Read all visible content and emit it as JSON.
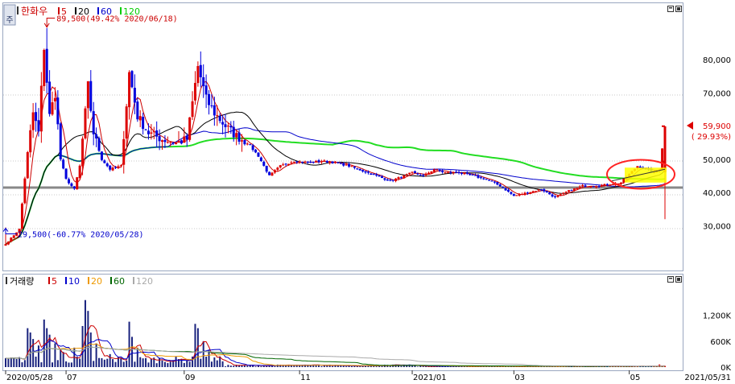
{
  "price_panel": {
    "symbol": "한화우",
    "ma_legend": [
      {
        "label": "5",
        "color": "#cc0000"
      },
      {
        "label": "20",
        "color": "#000000"
      },
      {
        "label": "60",
        "color": "#0000cc"
      },
      {
        "label": "120",
        "color": "#00cc00"
      }
    ],
    "high_annotation": "89,500(49.42% 2020/06/18)",
    "low_annotation": "29,500(-60.77% 2020/05/28)",
    "current_price": "59,900",
    "current_change": "( 29.93%)",
    "settings_icon_glyph": "주",
    "colors": {
      "up": "#dd0000",
      "down": "#0000dd",
      "ma5": "#cc0000",
      "ma20": "#000000",
      "ma60": "#0000cc",
      "ma120": "#22dd22",
      "support": "#888888",
      "circle": "#ff2222",
      "highlight": "#ffff00"
    }
  },
  "volume_panel": {
    "title": "거래량",
    "ma_legend": [
      {
        "label": "5",
        "color": "#cc0000"
      },
      {
        "label": "10",
        "color": "#0000cc"
      },
      {
        "label": "20",
        "color": "#ee9900"
      },
      {
        "label": "60",
        "color": "#006600"
      },
      {
        "label": "120",
        "color": "#aaaaaa"
      }
    ]
  },
  "x_axis": {
    "labels": [
      {
        "text": "2020/05/28",
        "idx": 0
      },
      {
        "text": "07",
        "idx": 22
      },
      {
        "text": "09",
        "idx": 65
      },
      {
        "text": "11",
        "idx": 107
      },
      {
        "text": "2021/01",
        "idx": 148
      },
      {
        "text": "03",
        "idx": 185
      },
      {
        "text": "05",
        "idx": 227
      }
    ],
    "end_label": "2021/05/31"
  },
  "chart_data": [
    {
      "type": "candlestick",
      "title": "한화우",
      "x_start": "2020/05/28",
      "x_end": "2021/05/31",
      "y_ticks": [
        30000,
        40000,
        50000,
        60000,
        70000,
        80000
      ],
      "ylim": [
        18000,
        96000
      ],
      "support_level": 41500,
      "anchors": [
        {
          "i": 0,
          "p": 24500
        },
        {
          "i": 5,
          "p": 29000
        },
        {
          "i": 8,
          "p": 52000
        },
        {
          "i": 10,
          "p": 64000
        },
        {
          "i": 12,
          "p": 58000
        },
        {
          "i": 14,
          "p": 84000
        },
        {
          "i": 16,
          "p": 63000
        },
        {
          "i": 18,
          "p": 70000
        },
        {
          "i": 20,
          "p": 50000
        },
        {
          "i": 22,
          "p": 44000
        },
        {
          "i": 25,
          "p": 41000
        },
        {
          "i": 27,
          "p": 48000
        },
        {
          "i": 30,
          "p": 72000
        },
        {
          "i": 32,
          "p": 58000
        },
        {
          "i": 35,
          "p": 50000
        },
        {
          "i": 38,
          "p": 47000
        },
        {
          "i": 42,
          "p": 48000
        },
        {
          "i": 45,
          "p": 76000
        },
        {
          "i": 48,
          "p": 63000
        },
        {
          "i": 52,
          "p": 58000
        },
        {
          "i": 57,
          "p": 56000
        },
        {
          "i": 62,
          "p": 55000
        },
        {
          "i": 66,
          "p": 56000
        },
        {
          "i": 70,
          "p": 78000
        },
        {
          "i": 73,
          "p": 68000
        },
        {
          "i": 76,
          "p": 64000
        },
        {
          "i": 80,
          "p": 60000
        },
        {
          "i": 84,
          "p": 57000
        },
        {
          "i": 88,
          "p": 55000
        },
        {
          "i": 92,
          "p": 51000
        },
        {
          "i": 96,
          "p": 45000
        },
        {
          "i": 100,
          "p": 48000
        },
        {
          "i": 105,
          "p": 49500
        },
        {
          "i": 110,
          "p": 49000
        },
        {
          "i": 115,
          "p": 49500
        },
        {
          "i": 120,
          "p": 49000
        },
        {
          "i": 125,
          "p": 48000
        },
        {
          "i": 130,
          "p": 46500
        },
        {
          "i": 135,
          "p": 45000
        },
        {
          "i": 140,
          "p": 43500
        },
        {
          "i": 145,
          "p": 45000
        },
        {
          "i": 148,
          "p": 46000
        },
        {
          "i": 152,
          "p": 45000
        },
        {
          "i": 156,
          "p": 47000
        },
        {
          "i": 160,
          "p": 46000
        },
        {
          "i": 165,
          "p": 46000
        },
        {
          "i": 170,
          "p": 45000
        },
        {
          "i": 175,
          "p": 44000
        },
        {
          "i": 180,
          "p": 42000
        },
        {
          "i": 185,
          "p": 39000
        },
        {
          "i": 190,
          "p": 40000
        },
        {
          "i": 195,
          "p": 41000
        },
        {
          "i": 200,
          "p": 38500
        },
        {
          "i": 205,
          "p": 40500
        },
        {
          "i": 210,
          "p": 42000
        },
        {
          "i": 215,
          "p": 42000
        },
        {
          "i": 220,
          "p": 42500
        },
        {
          "i": 224,
          "p": 43000
        },
        {
          "i": 227,
          "p": 45500
        },
        {
          "i": 230,
          "p": 48000
        },
        {
          "i": 233,
          "p": 47000
        },
        {
          "i": 236,
          "p": 46000
        },
        {
          "i": 238,
          "p": 47000
        },
        {
          "i": 240,
          "p": 59900
        }
      ],
      "current": {
        "value": 59900,
        "change_pct": 29.93
      },
      "high": {
        "value": 89500,
        "date": "2020/06/18",
        "pct": 49.42
      },
      "low": {
        "value": 29500,
        "date": "2020/05/28",
        "pct": -60.77
      }
    },
    {
      "type": "bar",
      "title": "거래량",
      "y_ticks": [
        {
          "value": 0,
          "label": "0K"
        },
        {
          "value": 600000,
          "label": "600K"
        },
        {
          "value": 1200000,
          "label": "1,200K"
        }
      ],
      "ylim": [
        0,
        1750000
      ],
      "spikes": [
        {
          "i": 3,
          "v": 220000
        },
        {
          "i": 8,
          "v": 900000
        },
        {
          "i": 9,
          "v": 800000
        },
        {
          "i": 10,
          "v": 650000
        },
        {
          "i": 12,
          "v": 500000
        },
        {
          "i": 14,
          "v": 1100000
        },
        {
          "i": 15,
          "v": 900000
        },
        {
          "i": 16,
          "v": 750000
        },
        {
          "i": 18,
          "v": 550000
        },
        {
          "i": 20,
          "v": 400000
        },
        {
          "i": 21,
          "v": 350000
        },
        {
          "i": 25,
          "v": 450000
        },
        {
          "i": 28,
          "v": 950000
        },
        {
          "i": 29,
          "v": 1550000
        },
        {
          "i": 30,
          "v": 1300000
        },
        {
          "i": 31,
          "v": 800000
        },
        {
          "i": 33,
          "v": 550000
        },
        {
          "i": 38,
          "v": 300000
        },
        {
          "i": 45,
          "v": 1050000
        },
        {
          "i": 46,
          "v": 700000
        },
        {
          "i": 48,
          "v": 450000
        },
        {
          "i": 69,
          "v": 1000000
        },
        {
          "i": 70,
          "v": 900000
        },
        {
          "i": 72,
          "v": 600000
        },
        {
          "i": 74,
          "v": 400000
        },
        {
          "i": 238,
          "v": 60000
        }
      ]
    }
  ]
}
